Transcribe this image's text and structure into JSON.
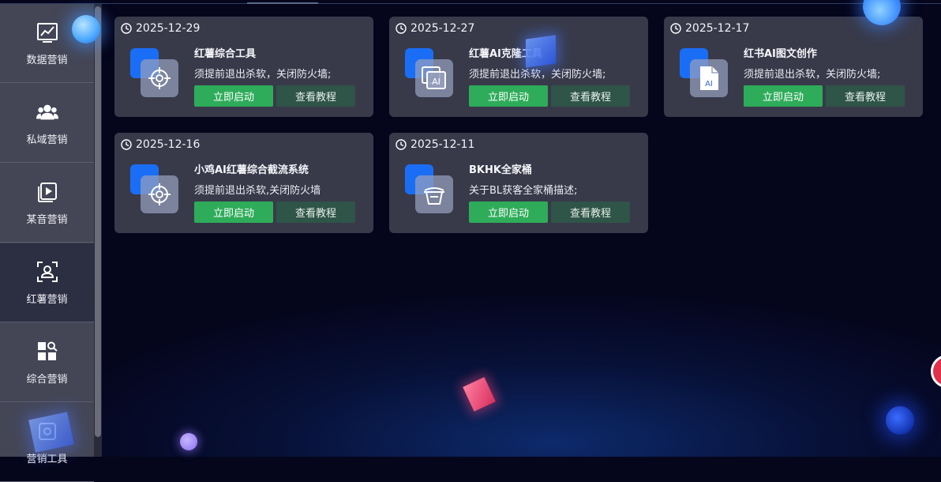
{
  "sidebar": {
    "items": [
      {
        "label": "数据营销",
        "icon": "chart-line-icon"
      },
      {
        "label": "私域营销",
        "icon": "users-icon"
      },
      {
        "label": "某音营销",
        "icon": "video-play-icon"
      },
      {
        "label": "红薯营销",
        "icon": "user-scan-icon"
      },
      {
        "label": "综合营销",
        "icon": "grid-search-icon"
      },
      {
        "label": "营销工具",
        "icon": "tool-box-icon"
      }
    ],
    "active_index": 3
  },
  "cards": [
    {
      "date": "2025-12-29",
      "title": "红薯综合工具",
      "desc": "须提前退出杀软，关闭防火墙;",
      "icon": "crosshair-icon",
      "start_label": "立即启动",
      "guide_label": "查看教程"
    },
    {
      "date": "2025-12-27",
      "title": "红薯AI克隆工具",
      "desc": "须提前退出杀软，关闭防火墙;",
      "icon": "ai-window-icon",
      "start_label": "立即启动",
      "guide_label": "查看教程"
    },
    {
      "date": "2025-12-17",
      "title": "红书AI图文创作",
      "desc": "须提前退出杀软，关闭防火墙;",
      "icon": "ai-document-icon",
      "start_label": "立即启动",
      "guide_label": "查看教程"
    },
    {
      "date": "2025-12-16",
      "title": "小鸡AI红薯综合截流系统",
      "desc": "须提前退出杀软,关闭防火墙",
      "icon": "crosshair-icon",
      "start_label": "立即启动",
      "guide_label": "查看教程"
    },
    {
      "date": "2025-12-11",
      "title": "BKHK全家桶",
      "desc": "关于BL获客全家桶描述;",
      "icon": "basket-icon",
      "start_label": "立即启动",
      "guide_label": "查看教程"
    }
  ],
  "colors": {
    "start_button": "#2eac5a",
    "guide_button": "#2f5448",
    "card_bg": "#383a4a",
    "sidebar_bg": "#444656",
    "icon_blue": "#1a6ef5"
  }
}
